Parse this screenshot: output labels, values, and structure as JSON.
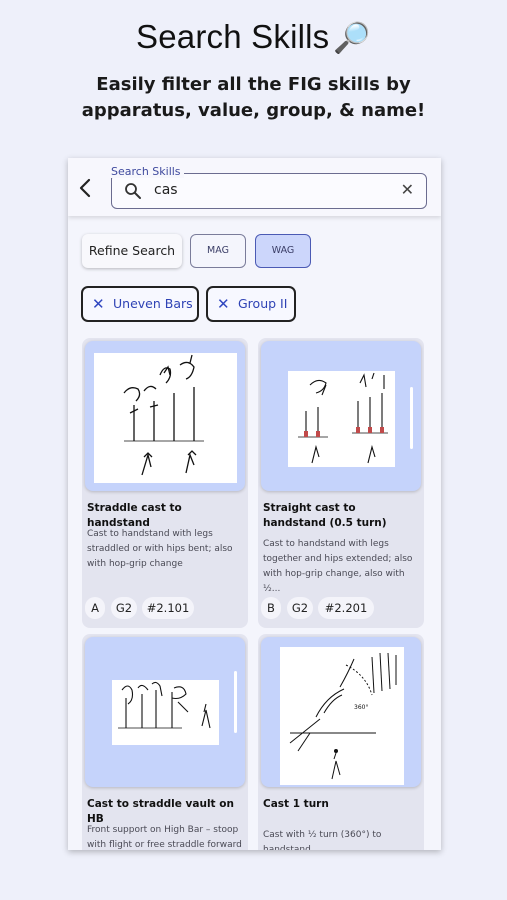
{
  "promo": {
    "title": "Search Skills",
    "subtitle_line1": "Easily filter all the FIG skills by",
    "subtitle_line2": "apparatus, value, group, & name!"
  },
  "search": {
    "label": "Search Skills",
    "value": "cas",
    "back_icon": "chevron-left-icon",
    "search_icon": "search-icon",
    "clear_icon": "close-icon"
  },
  "filters": {
    "refine_label": "Refine Search",
    "mag_label": "MAG",
    "wag_label": "WAG",
    "selected": "WAG",
    "chips": [
      "Uneven Bars",
      "Group II"
    ]
  },
  "skills": [
    {
      "name": "Straddle cast to handstand",
      "description": [
        "Cast to handstand with legs",
        "straddled or with hips bent; also",
        "with hop-grip change"
      ],
      "value": "A",
      "group": "G2",
      "number": "#2.101"
    },
    {
      "name": "Straight cast to handstand (0.5 turn)",
      "description": [
        "Cast to handstand with legs",
        "together and hips extended; also",
        "with hop-grip change, also with ½..."
      ],
      "value": "B",
      "group": "G2",
      "number": "#2.201"
    },
    {
      "name": "Cast to straddle vault on HB",
      "description": [
        "Front support on High Bar – stoop",
        "with flight or free straddle forward"
      ],
      "value": "",
      "group": "",
      "number": ""
    },
    {
      "name": "Cast 1 turn",
      "description": [
        "Cast with ½ turn (360°) to",
        "handstand"
      ],
      "value": "",
      "group": "",
      "number": ""
    }
  ],
  "diagram_text": {
    "degrees": "360°"
  },
  "colors": {
    "background": "#eef0fa",
    "accent": "#3047c0",
    "selected_segment": "#ccd6fb",
    "card_image_bg": "#c5d3fb"
  }
}
